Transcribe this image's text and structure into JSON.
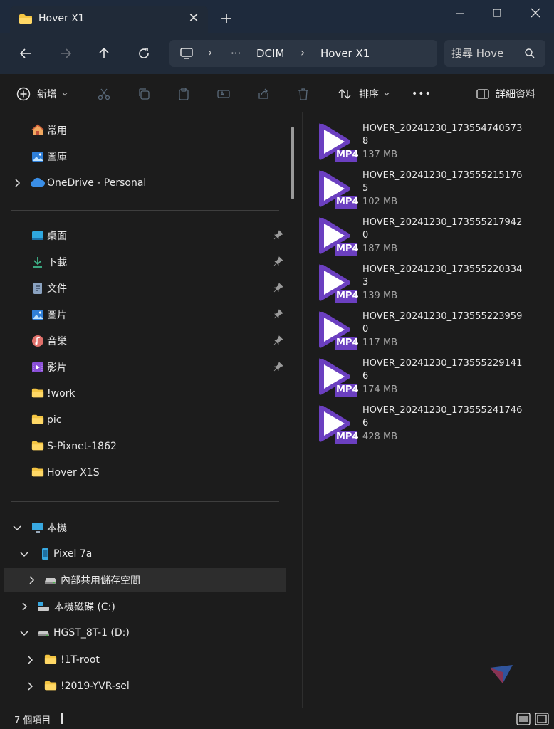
{
  "window": {
    "tab_title": "Hover X1",
    "new_tab_label": "+",
    "close_tab_label": "✕"
  },
  "address": {
    "overflow": "···",
    "crumbs": [
      "DCIM",
      "Hover X1"
    ]
  },
  "search": {
    "placeholder": "搜尋 Hove"
  },
  "commands": {
    "new_label": "新增",
    "sort_label": "排序",
    "more_label": "•••",
    "details_label": "詳細資料"
  },
  "sidebar": {
    "top": [
      {
        "label": "常用",
        "icon": "home-icon"
      },
      {
        "label": "圖庫",
        "icon": "gallery-icon"
      },
      {
        "label": "OneDrive - Personal",
        "icon": "onedrive-cloud-icon"
      }
    ],
    "quick": [
      {
        "label": "桌面",
        "icon": "desktop-icon",
        "pinned": true
      },
      {
        "label": "下載",
        "icon": "download-icon",
        "pinned": true
      },
      {
        "label": "文件",
        "icon": "documents-icon",
        "pinned": true
      },
      {
        "label": "圖片",
        "icon": "pictures-icon",
        "pinned": true
      },
      {
        "label": "音樂",
        "icon": "music-icon",
        "pinned": true
      },
      {
        "label": "影片",
        "icon": "videos-icon",
        "pinned": true
      },
      {
        "label": "!work",
        "icon": "folder-icon",
        "pinned": false
      },
      {
        "label": "pic",
        "icon": "folder-icon",
        "pinned": false
      },
      {
        "label": "S-Pixnet-1862",
        "icon": "folder-icon",
        "pinned": false
      },
      {
        "label": "Hover X1S",
        "icon": "folder-icon",
        "pinned": false
      }
    ],
    "tree": [
      {
        "label": "本機",
        "icon": "this-pc-icon"
      },
      {
        "label": "Pixel 7a",
        "icon": "phone-icon"
      },
      {
        "label": "內部共用儲存空間",
        "icon": "drive-icon"
      },
      {
        "label": "本機磁碟 (C:)",
        "icon": "windows-drive-icon"
      },
      {
        "label": "HGST_8T-1 (D:)",
        "icon": "drive-icon"
      },
      {
        "label": "!1T-root",
        "icon": "folder-icon"
      },
      {
        "label": "!2019-YVR-sel",
        "icon": "folder-icon"
      }
    ]
  },
  "files": [
    {
      "name": "HOVER_20241230_1735547405738",
      "size": "137 MB",
      "badge": "MP4"
    },
    {
      "name": "HOVER_20241230_1735552151765",
      "size": "102 MB",
      "badge": "MP4"
    },
    {
      "name": "HOVER_20241230_1735552179420",
      "size": "187 MB",
      "badge": "MP4"
    },
    {
      "name": "HOVER_20241230_1735552203343",
      "size": "139 MB",
      "badge": "MP4"
    },
    {
      "name": "HOVER_20241230_1735552239590",
      "size": "117 MB",
      "badge": "MP4"
    },
    {
      "name": "HOVER_20241230_1735552291416",
      "size": "174 MB",
      "badge": "MP4"
    },
    {
      "name": "HOVER_20241230_1735552417466",
      "size": "428 MB",
      "badge": "MP4"
    }
  ],
  "status": {
    "item_count": "7 個項目"
  },
  "colors": {
    "accent_purple": "#6b3fc0",
    "folder_yellow": "#f4c542",
    "onedrive_blue": "#3a8ee6"
  }
}
